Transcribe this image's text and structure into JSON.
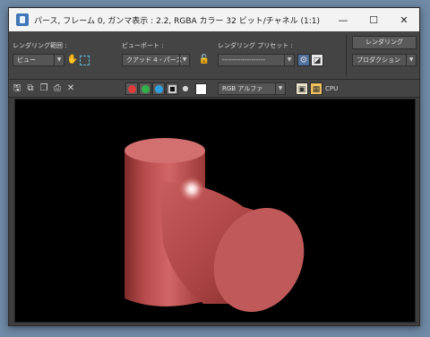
{
  "window": {
    "title": "パース, フレーム 0, ガンマ表示 : 2.2, RGBA カラー 32 ビット/チャネル (1:1)",
    "minimize_glyph": "—",
    "maximize_glyph": "☐",
    "close_glyph": "✕"
  },
  "toolbar": {
    "area_label": "レンダリング範囲 :",
    "area_value": "ビュー",
    "viewport_label": "ビューポート :",
    "viewport_value": "クアッド 4 - パース",
    "preset_label": "レンダリング プリセット :",
    "preset_value": "-------------------",
    "render_button": "レンダリング",
    "production_value": "プロダクション"
  },
  "toolbar2": {
    "channel_value": "RGB アルファ",
    "cpu_label": "CPU",
    "channel_colors": {
      "red": "#e23b3b",
      "green": "#33b04a",
      "blue": "#2f9fe0"
    }
  },
  "icons": [
    "save-icon",
    "copy-icon",
    "clone-icon",
    "print-icon",
    "clear-icon",
    "lock-icon",
    "crop-icon",
    "pan-icon"
  ]
}
